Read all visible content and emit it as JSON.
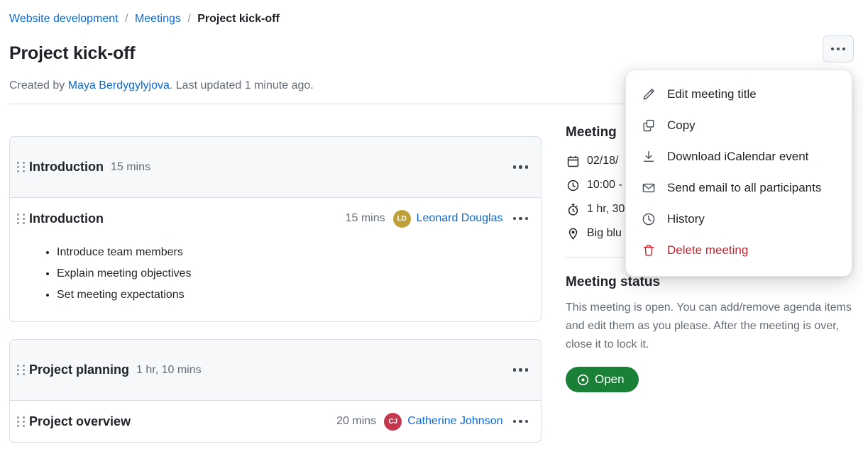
{
  "breadcrumb": {
    "items": [
      {
        "label": "Website development",
        "current": false
      },
      {
        "label": "Meetings",
        "current": false
      },
      {
        "label": "Project kick-off",
        "current": true
      }
    ],
    "separator": "/"
  },
  "header": {
    "title": "Project kick-off",
    "created_prefix": "Created by ",
    "created_by": "Maya Berdygylyjova",
    "created_suffix": ". Last updated 1 minute ago.",
    "kebab_label": "..."
  },
  "menu": {
    "items": [
      {
        "label": "Edit meeting title",
        "icon": "pencil-icon",
        "danger": false
      },
      {
        "label": "Copy",
        "icon": "copy-icon",
        "danger": false
      },
      {
        "label": "Download iCalendar event",
        "icon": "download-icon",
        "danger": false
      },
      {
        "label": "Send email to all participants",
        "icon": "envelope-icon",
        "danger": false
      },
      {
        "label": "History",
        "icon": "clock-icon",
        "danger": false
      },
      {
        "label": "Delete meeting",
        "icon": "trash-icon",
        "danger": true
      }
    ]
  },
  "agenda": {
    "sections": [
      {
        "title": "Introduction",
        "duration": "15 mins",
        "items": [
          {
            "title": "Introduction",
            "duration": "15 mins",
            "owner": "Leonard Douglas",
            "owner_initials": "LD",
            "owner_color": "#bfa13a",
            "bullets": [
              "Introduce team members",
              "Explain meeting objectives",
              "Set meeting expectations"
            ]
          }
        ]
      },
      {
        "title": "Project planning",
        "duration": "1 hr, 10 mins",
        "items": [
          {
            "title": "Project overview",
            "duration": "20 mins",
            "owner": "Catherine Johnson",
            "owner_initials": "CJ",
            "owner_color": "#c3384f",
            "bullets": []
          }
        ]
      }
    ]
  },
  "sidebar": {
    "details_title": "Meeting",
    "details": [
      {
        "icon": "calendar-icon",
        "value": "02/18/"
      },
      {
        "icon": "clock-icon",
        "value": "10:00 -"
      },
      {
        "icon": "stopwatch-icon",
        "value": "1 hr, 30"
      },
      {
        "icon": "location-pin-icon",
        "value": "Big blu"
      }
    ],
    "status_title": "Meeting status",
    "status_text": "This meeting is open. You can add/remove agenda items and edit them as you please. After the meeting is over, close it to lock it.",
    "status_badge": "Open",
    "status_badge_color": "#1a7f37"
  }
}
